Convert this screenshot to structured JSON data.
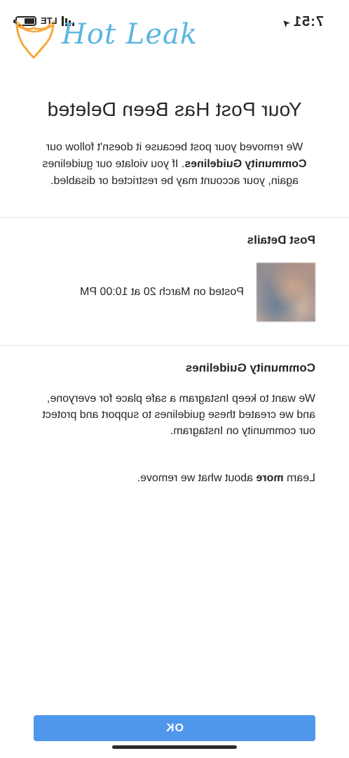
{
  "status_bar": {
    "time": "7:51",
    "network": "LTE"
  },
  "watermark": {
    "text": "Hot Leak",
    "color": "#5ab6e0",
    "accent": "#f7a83a"
  },
  "dialog": {
    "title": "Your Post Has Been Deleted",
    "intro_part1": "We removed your post because it doesn't follow our ",
    "intro_bold": "Community Guidelines",
    "intro_part2": ". If you violate our guidelines again, your account may be restricted or disabled."
  },
  "post_details": {
    "heading": "Post Details",
    "posted_on": "Posted on March 20 at 10:00 PM"
  },
  "guidelines": {
    "heading": "Community Guidelines",
    "text": "We want to keep Instagram a safe place for everyone, and we created these guidelines to support and protect our community on Instagram.",
    "learn_prefix": "Learn ",
    "learn_bold": "more",
    "learn_suffix": " about what we remove."
  },
  "actions": {
    "ok_label": "OK"
  },
  "colors": {
    "button": "#4f97ea",
    "text": "#262626",
    "divider": "#e6e6e6"
  }
}
